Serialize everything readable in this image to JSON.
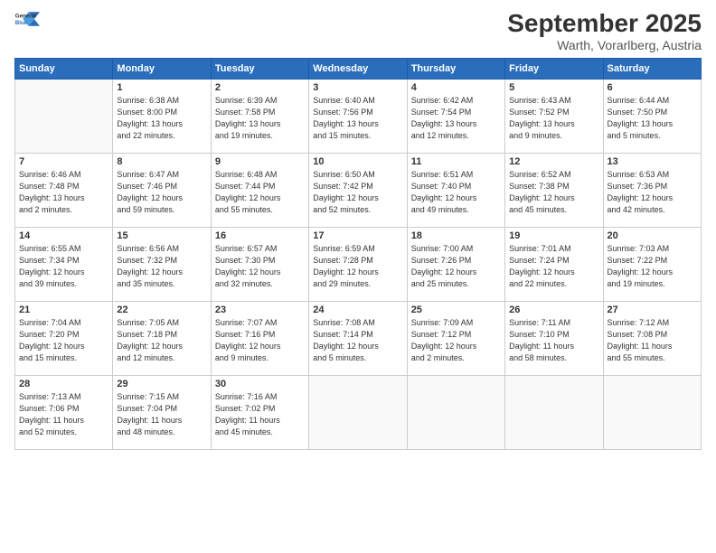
{
  "logo": {
    "general": "General",
    "blue": "Blue"
  },
  "title": "September 2025",
  "subtitle": "Warth, Vorarlberg, Austria",
  "headers": [
    "Sunday",
    "Monday",
    "Tuesday",
    "Wednesday",
    "Thursday",
    "Friday",
    "Saturday"
  ],
  "weeks": [
    [
      {
        "day": "",
        "info": ""
      },
      {
        "day": "1",
        "info": "Sunrise: 6:38 AM\nSunset: 8:00 PM\nDaylight: 13 hours\nand 22 minutes."
      },
      {
        "day": "2",
        "info": "Sunrise: 6:39 AM\nSunset: 7:58 PM\nDaylight: 13 hours\nand 19 minutes."
      },
      {
        "day": "3",
        "info": "Sunrise: 6:40 AM\nSunset: 7:56 PM\nDaylight: 13 hours\nand 15 minutes."
      },
      {
        "day": "4",
        "info": "Sunrise: 6:42 AM\nSunset: 7:54 PM\nDaylight: 13 hours\nand 12 minutes."
      },
      {
        "day": "5",
        "info": "Sunrise: 6:43 AM\nSunset: 7:52 PM\nDaylight: 13 hours\nand 9 minutes."
      },
      {
        "day": "6",
        "info": "Sunrise: 6:44 AM\nSunset: 7:50 PM\nDaylight: 13 hours\nand 5 minutes."
      }
    ],
    [
      {
        "day": "7",
        "info": "Sunrise: 6:46 AM\nSunset: 7:48 PM\nDaylight: 13 hours\nand 2 minutes."
      },
      {
        "day": "8",
        "info": "Sunrise: 6:47 AM\nSunset: 7:46 PM\nDaylight: 12 hours\nand 59 minutes."
      },
      {
        "day": "9",
        "info": "Sunrise: 6:48 AM\nSunset: 7:44 PM\nDaylight: 12 hours\nand 55 minutes."
      },
      {
        "day": "10",
        "info": "Sunrise: 6:50 AM\nSunset: 7:42 PM\nDaylight: 12 hours\nand 52 minutes."
      },
      {
        "day": "11",
        "info": "Sunrise: 6:51 AM\nSunset: 7:40 PM\nDaylight: 12 hours\nand 49 minutes."
      },
      {
        "day": "12",
        "info": "Sunrise: 6:52 AM\nSunset: 7:38 PM\nDaylight: 12 hours\nand 45 minutes."
      },
      {
        "day": "13",
        "info": "Sunrise: 6:53 AM\nSunset: 7:36 PM\nDaylight: 12 hours\nand 42 minutes."
      }
    ],
    [
      {
        "day": "14",
        "info": "Sunrise: 6:55 AM\nSunset: 7:34 PM\nDaylight: 12 hours\nand 39 minutes."
      },
      {
        "day": "15",
        "info": "Sunrise: 6:56 AM\nSunset: 7:32 PM\nDaylight: 12 hours\nand 35 minutes."
      },
      {
        "day": "16",
        "info": "Sunrise: 6:57 AM\nSunset: 7:30 PM\nDaylight: 12 hours\nand 32 minutes."
      },
      {
        "day": "17",
        "info": "Sunrise: 6:59 AM\nSunset: 7:28 PM\nDaylight: 12 hours\nand 29 minutes."
      },
      {
        "day": "18",
        "info": "Sunrise: 7:00 AM\nSunset: 7:26 PM\nDaylight: 12 hours\nand 25 minutes."
      },
      {
        "day": "19",
        "info": "Sunrise: 7:01 AM\nSunset: 7:24 PM\nDaylight: 12 hours\nand 22 minutes."
      },
      {
        "day": "20",
        "info": "Sunrise: 7:03 AM\nSunset: 7:22 PM\nDaylight: 12 hours\nand 19 minutes."
      }
    ],
    [
      {
        "day": "21",
        "info": "Sunrise: 7:04 AM\nSunset: 7:20 PM\nDaylight: 12 hours\nand 15 minutes."
      },
      {
        "day": "22",
        "info": "Sunrise: 7:05 AM\nSunset: 7:18 PM\nDaylight: 12 hours\nand 12 minutes."
      },
      {
        "day": "23",
        "info": "Sunrise: 7:07 AM\nSunset: 7:16 PM\nDaylight: 12 hours\nand 9 minutes."
      },
      {
        "day": "24",
        "info": "Sunrise: 7:08 AM\nSunset: 7:14 PM\nDaylight: 12 hours\nand 5 minutes."
      },
      {
        "day": "25",
        "info": "Sunrise: 7:09 AM\nSunset: 7:12 PM\nDaylight: 12 hours\nand 2 minutes."
      },
      {
        "day": "26",
        "info": "Sunrise: 7:11 AM\nSunset: 7:10 PM\nDaylight: 11 hours\nand 58 minutes."
      },
      {
        "day": "27",
        "info": "Sunrise: 7:12 AM\nSunset: 7:08 PM\nDaylight: 11 hours\nand 55 minutes."
      }
    ],
    [
      {
        "day": "28",
        "info": "Sunrise: 7:13 AM\nSunset: 7:06 PM\nDaylight: 11 hours\nand 52 minutes."
      },
      {
        "day": "29",
        "info": "Sunrise: 7:15 AM\nSunset: 7:04 PM\nDaylight: 11 hours\nand 48 minutes."
      },
      {
        "day": "30",
        "info": "Sunrise: 7:16 AM\nSunset: 7:02 PM\nDaylight: 11 hours\nand 45 minutes."
      },
      {
        "day": "",
        "info": ""
      },
      {
        "day": "",
        "info": ""
      },
      {
        "day": "",
        "info": ""
      },
      {
        "day": "",
        "info": ""
      }
    ]
  ]
}
